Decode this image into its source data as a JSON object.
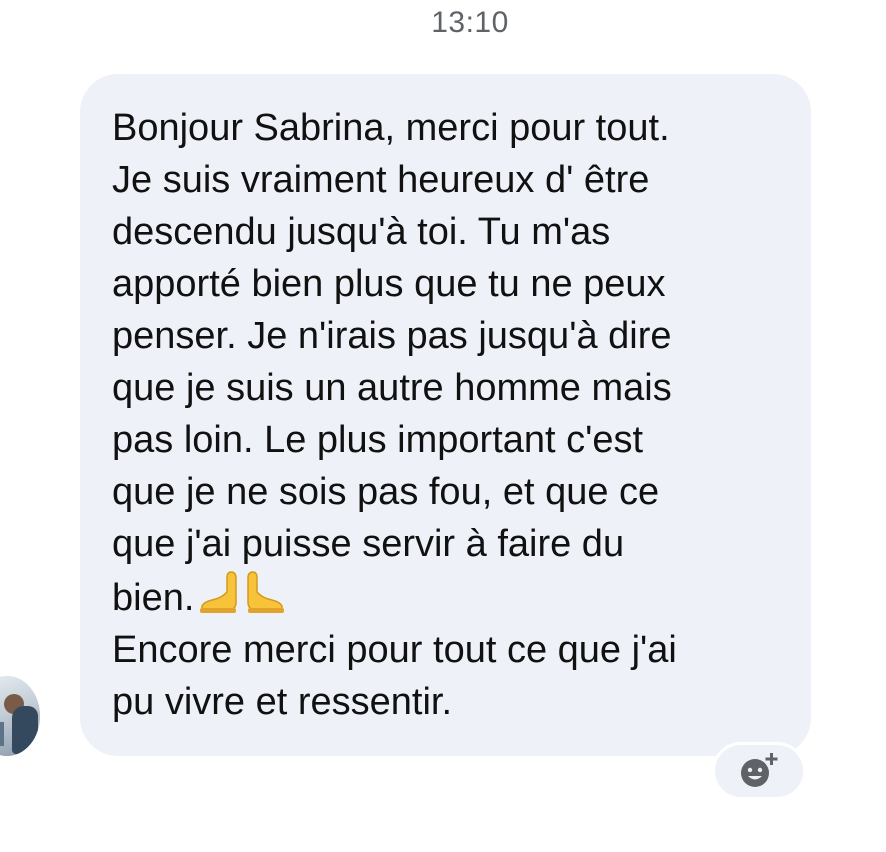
{
  "conversation": {
    "timestamp": "13:10"
  },
  "message": {
    "text_main": "Bonjour Sabrina, merci pour tout.\nJe suis vraiment heureux d' être\ndescendu jusqu'à toi. Tu m'as\napporté bien plus que tu ne peux\npenser. Je n'irais pas jusqu'à dire\nque je suis un autre homme mais\npas loin. Le plus important c'est\nque je ne sois pas fou, et que ce\nque j'ai puisse servir à faire du\nbien.",
    "emoji_icon": "folded-hands-icon",
    "text_end": "\nEncore merci pour tout ce que j'ai\npu vivre et ressentir."
  },
  "sender": {
    "avatar_icon": "sender-avatar"
  },
  "reaction": {
    "icon": "add-reaction-icon"
  }
}
